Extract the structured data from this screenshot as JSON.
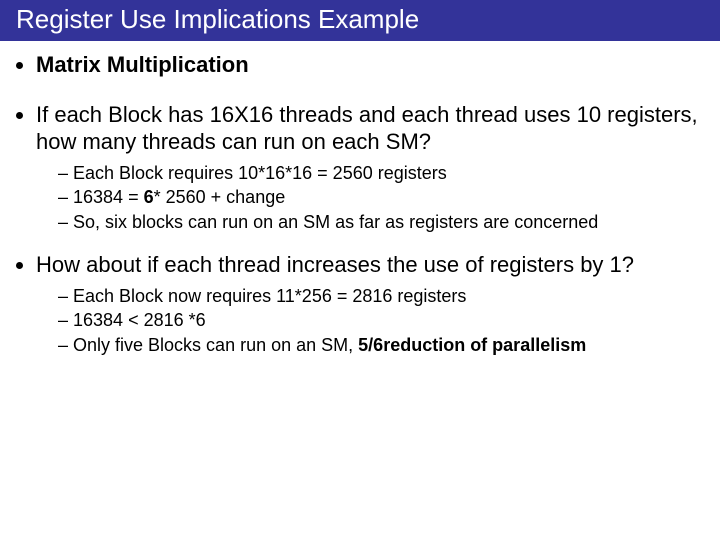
{
  "title": "Register Use Implications Example",
  "b1": {
    "text": "Matrix Multiplication"
  },
  "b2": {
    "text": "If each Block has 16X16 threads and each thread uses 10 registers, how many threads can run on each SM?",
    "s1_a": "Each Block requires 10*16*16 = 2560 registers",
    "s2_a": "16384 = ",
    "s2_b": "6",
    "s2_c": "* 2560 + change",
    "s3_a": "So, six blocks can run on an SM as far as registers are concerned"
  },
  "b3": {
    "text": "How about if each thread increases the use of registers by 1?",
    "s1_a": "Each  Block now requires 11*256 = 2816 registers",
    "s2_a": "16384 < 2816 *6",
    "s3_a": "Only five Blocks can run on an SM, ",
    "s3_b": "5/6",
    "s3_c": "reduction of parallelism"
  }
}
